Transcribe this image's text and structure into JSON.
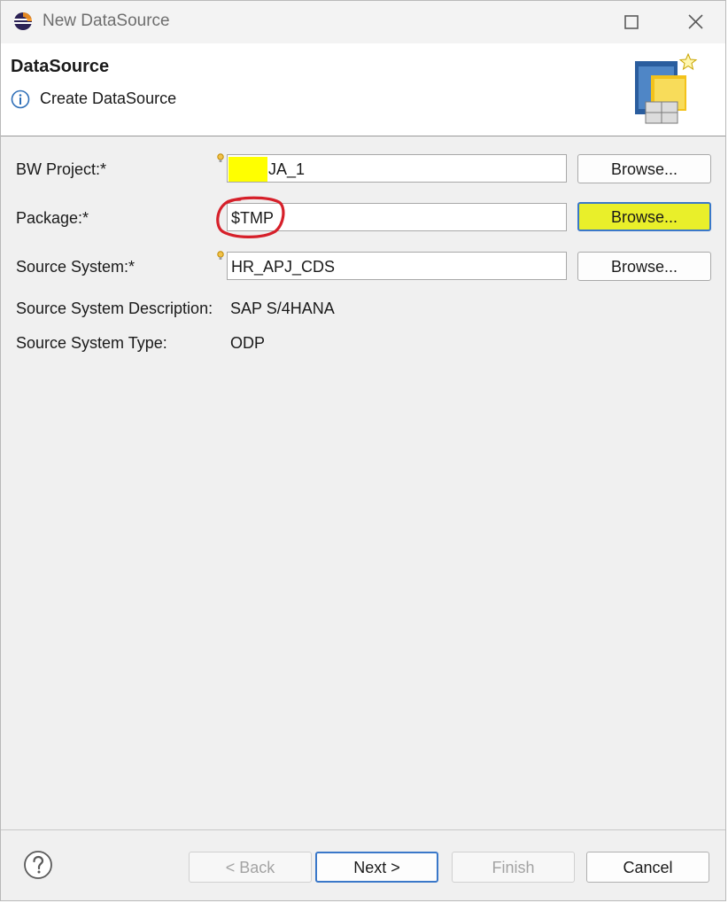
{
  "window": {
    "title": "New DataSource"
  },
  "banner": {
    "title": "DataSource",
    "message": "Create DataSource"
  },
  "form": {
    "bw_project": {
      "label": "BW Project:*",
      "value": "JA_1",
      "browse": "Browse..."
    },
    "package": {
      "label": "Package:*",
      "value": "$TMP",
      "browse": "Browse..."
    },
    "source_system": {
      "label": "Source System:*",
      "value": "HR_APJ_CDS",
      "browse": "Browse..."
    },
    "source_system_description": {
      "label": "Source System Description:",
      "value": "SAP S/4HANA"
    },
    "source_system_type": {
      "label": "Source System Type:",
      "value": "ODP"
    }
  },
  "footer": {
    "back": "< Back",
    "next": "Next >",
    "finish": "Finish",
    "cancel": "Cancel"
  },
  "colors": {
    "highlight": "#e9ef2a",
    "annotation_red": "#d6202a",
    "focus_blue": "#3a78c9"
  }
}
